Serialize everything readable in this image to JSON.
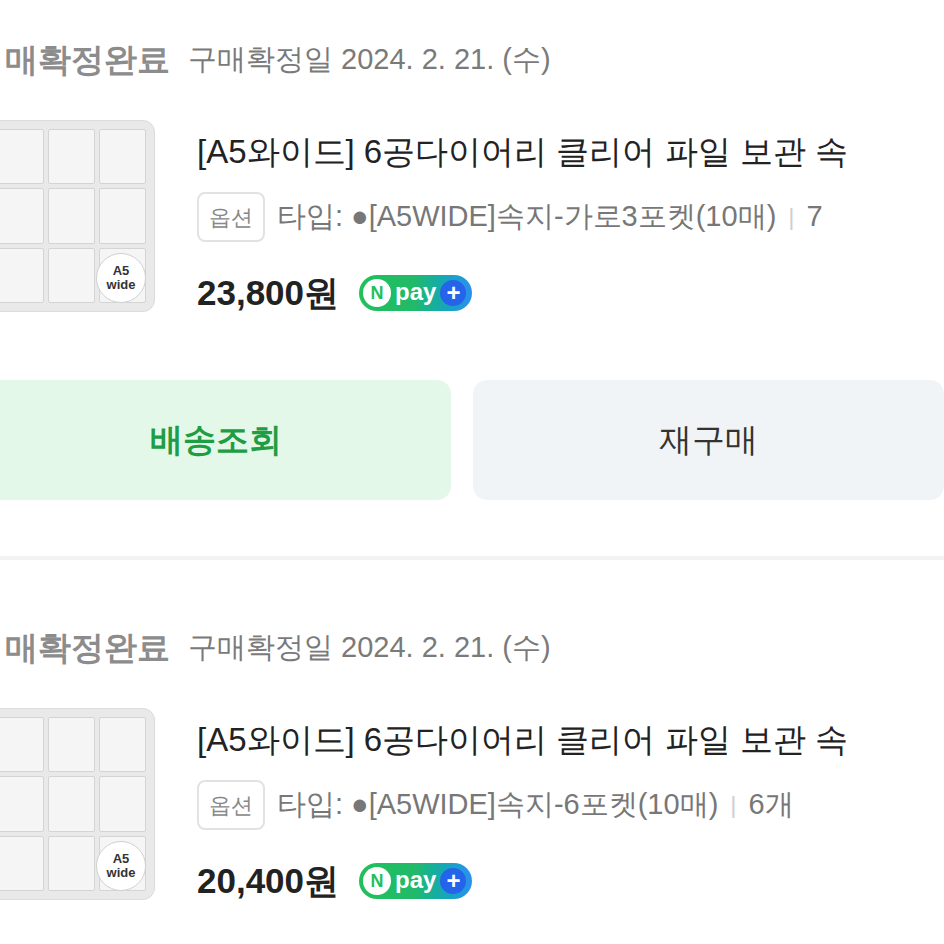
{
  "orders": [
    {
      "status": "매확정완료",
      "confirmed_date": "구매확정일 2024. 2. 21. (수)",
      "thumbnail_badge": [
        "A5",
        "wide"
      ],
      "title": "[A5와이드] 6공다이어리 클리어 파일 보관 속",
      "option_label": "옵션",
      "option": "타입: ●[A5WIDE]속지-가로3포켓(10매)",
      "separator": "|",
      "quantity": "7",
      "price": "23,800원",
      "pay_badge": {
        "n": "N",
        "pay": "pay",
        "plus": "+"
      },
      "buttons": [
        {
          "label": "배송조회",
          "kind": "primary"
        },
        {
          "label": "재구매",
          "kind": "secondary"
        }
      ]
    },
    {
      "status": "매확정완료",
      "confirmed_date": "구매확정일 2024. 2. 21. (수)",
      "thumbnail_badge": [
        "A5",
        "wide"
      ],
      "title": "[A5와이드] 6공다이어리 클리어 파일 보관 속",
      "option_label": "옵션",
      "option": "타입: ●[A5WIDE]속지-6포켓(10매)",
      "separator": "|",
      "quantity": "6개",
      "price": "20,400원",
      "pay_badge": {
        "n": "N",
        "pay": "pay",
        "plus": "+"
      },
      "buttons": []
    }
  ]
}
